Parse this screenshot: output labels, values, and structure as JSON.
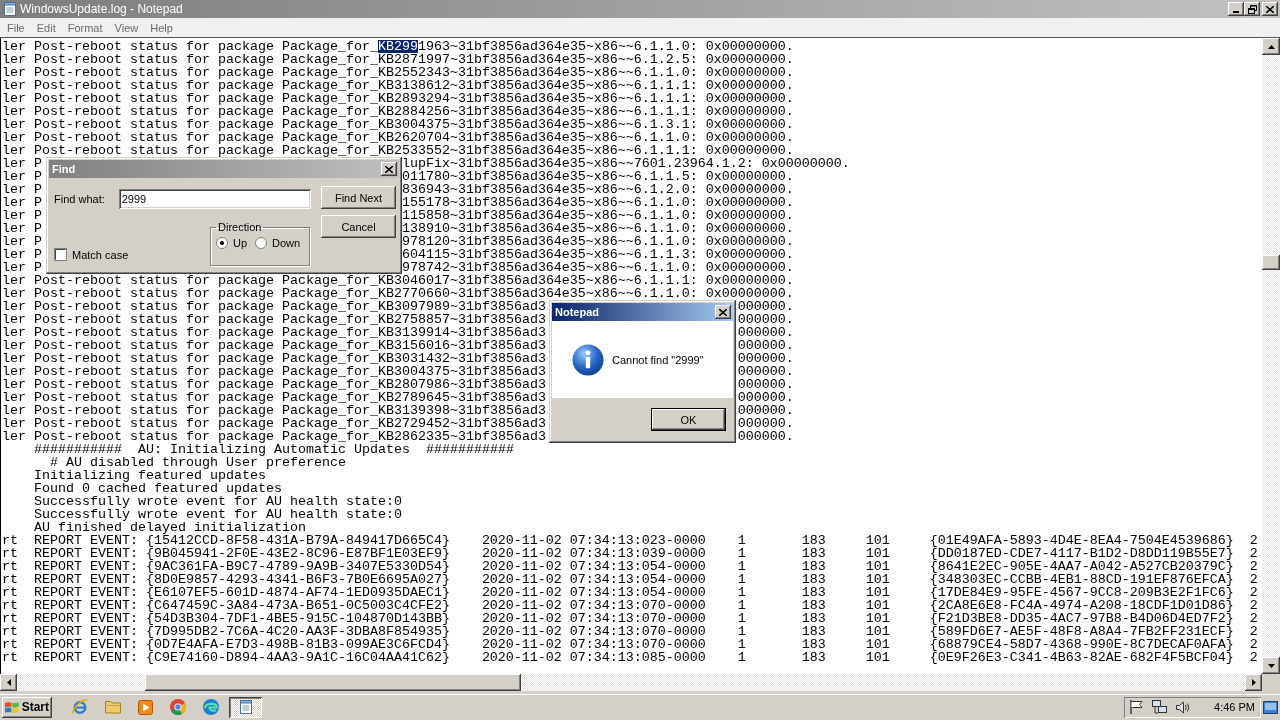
{
  "window": {
    "title": "WindowsUpdate.log - Notepad",
    "active": false
  },
  "menu": [
    "File",
    "Edit",
    "Format",
    "View",
    "Help"
  ],
  "log": {
    "lines": [
      {
        "kind": "full",
        "text": "ler Post-reboot status for package Package_for_",
        "selection": "KB299",
        "after": "1963~31bf3856ad364e35~x86~~6.1.1.0: 0x00000000."
      },
      {
        "kind": "full",
        "text": "ler Post-reboot status for package Package_for_KB2871997~31bf3856ad364e35~x86~~6.1.2.5: 0x00000000."
      },
      {
        "kind": "full",
        "text": "ler Post-reboot status for package Package_for_KB2552343~31bf3856ad364e35~x86~~6.1.1.0: 0x00000000."
      },
      {
        "kind": "full",
        "text": "ler Post-reboot status for package Package_for_KB3138612~31bf3856ad364e35~x86~~6.1.1.1: 0x00000000."
      },
      {
        "kind": "full",
        "text": "ler Post-reboot status for package Package_for_KB2893294~31bf3856ad364e35~x86~~6.1.1.1: 0x00000000."
      },
      {
        "kind": "full",
        "text": "ler Post-reboot status for package Package_for_KB2884256~31bf3856ad364e35~x86~~6.1.1.1: 0x00000000."
      },
      {
        "kind": "full",
        "text": "ler Post-reboot status for package Package_for_KB3004375~31bf3856ad364e35~x86~~6.1.3.1: 0x00000000."
      },
      {
        "kind": "full",
        "text": "ler Post-reboot status for package Package_for_KB2620704~31bf3856ad364e35~x86~~6.1.1.0: 0x00000000."
      },
      {
        "kind": "full",
        "text": "ler Post-reboot status for package Package_for_KB2533552~31bf3856ad364e35~x86~~6.1.1.1: 0x00000000."
      },
      {
        "kind": "behind_find",
        "text": "ler P",
        "tail": "lupFix~31bf3856ad364e35~x86~~7601.23964.1.2: 0x00000000."
      },
      {
        "kind": "behind_find",
        "text": "ler P",
        "tail": "011780~31bf3856ad364e35~x86~~6.1.1.5: 0x00000000."
      },
      {
        "kind": "behind_find",
        "text": "ler P",
        "tail": "836943~31bf3856ad364e35~x86~~6.1.2.0: 0x00000000."
      },
      {
        "kind": "behind_find",
        "text": "ler P",
        "tail": "155178~31bf3856ad364e35~x86~~6.1.1.0: 0x00000000."
      },
      {
        "kind": "behind_find",
        "text": "ler P",
        "tail": "115858~31bf3856ad364e35~x86~~6.1.1.0: 0x00000000."
      },
      {
        "kind": "behind_find",
        "text": "ler P",
        "tail": "138910~31bf3856ad364e35~x86~~6.1.1.0: 0x00000000."
      },
      {
        "kind": "behind_find",
        "text": "ler P",
        "tail": "978120~31bf3856ad364e35~x86~~6.1.1.0: 0x00000000."
      },
      {
        "kind": "behind_find",
        "text": "ler P",
        "tail": "604115~31bf3856ad364e35~x86~~6.1.1.3: 0x00000000."
      },
      {
        "kind": "behind_find",
        "text": "ler P",
        "tail": "978742~31bf3856ad364e35~x86~~6.1.1.0: 0x00000000."
      },
      {
        "kind": "full",
        "text": "ler Post-reboot status for package Package_for_KB3046017~31bf3856ad364e35~x86~~6.1.1.1: 0x00000000."
      },
      {
        "kind": "full",
        "text": "ler Post-reboot status for package Package_for_KB2770660~31bf3856ad364e35~x86~~6.1.1.0: 0x00000000."
      },
      {
        "kind": "behind_message",
        "text": "ler Post-reboot status for package Package_for_KB3097989~31bf3856ad3",
        "tail": "000000."
      },
      {
        "kind": "behind_message",
        "text": "ler Post-reboot status for package Package_for_KB2758857~31bf3856ad3",
        "tail": "000000."
      },
      {
        "kind": "behind_message",
        "text": "ler Post-reboot status for package Package_for_KB3139914~31bf3856ad3",
        "tail": "000000."
      },
      {
        "kind": "behind_message",
        "text": "ler Post-reboot status for package Package_for_KB3156016~31bf3856ad3",
        "tail": "000000."
      },
      {
        "kind": "behind_message",
        "text": "ler Post-reboot status for package Package_for_KB3031432~31bf3856ad3",
        "tail": "000000."
      },
      {
        "kind": "behind_message",
        "text": "ler Post-reboot status for package Package_for_KB3004375~31bf3856ad3",
        "tail": "000000."
      },
      {
        "kind": "behind_message",
        "text": "ler Post-reboot status for package Package_for_KB2807986~31bf3856ad3",
        "tail": "000000."
      },
      {
        "kind": "behind_message",
        "text": "ler Post-reboot status for package Package_for_KB2789645~31bf3856ad3",
        "tail": "000000."
      },
      {
        "kind": "behind_message",
        "text": "ler Post-reboot status for package Package_for_KB3139398~31bf3856ad3",
        "tail": "000000."
      },
      {
        "kind": "behind_message",
        "text": "ler Post-reboot status for package Package_for_KB2729452~31bf3856ad3",
        "tail": "000000."
      },
      {
        "kind": "behind_message",
        "text": "ler Post-reboot status for package Package_for_KB2862335~31bf3856ad3",
        "tail": "000000."
      },
      {
        "kind": "au",
        "text": "###########  AU: Initializing Automatic Updates  ###########"
      },
      {
        "kind": "au_detail",
        "text": "# AU disabled through User preference"
      },
      {
        "kind": "au",
        "text": "Initializing featured updates"
      },
      {
        "kind": "au",
        "text": "Found 0 cached featured updates"
      },
      {
        "kind": "au",
        "text": "Successfully wrote event for AU health state:0"
      },
      {
        "kind": "au",
        "text": "Successfully wrote event for AU health state:0"
      },
      {
        "kind": "au",
        "text": "AU finished delayed initialization"
      }
    ],
    "report_rows": [
      {
        "cells": [
          "rt",
          "REPORT EVENT: {15412CCD-8F58-431A-B79A-849417D665C4}",
          "2020-11-02 07:34:13:023-0000",
          "1",
          "183",
          "101",
          "{01E49AFA-5893-4D4E-8EA4-7504E4539686}",
          "2"
        ]
      },
      {
        "cells": [
          "rt",
          "REPORT EVENT: {9B045941-2F0E-43E2-8C96-E87BF1E03EF9}",
          "2020-11-02 07:34:13:039-0000",
          "1",
          "183",
          "101",
          "{DD0187ED-CDE7-4117-B1D2-D8DD119B55E7}",
          "2"
        ]
      },
      {
        "cells": [
          "rt",
          "REPORT EVENT: {9AC361FA-B9C7-4789-9A9B-3407E5330D54}",
          "2020-11-02 07:34:13:054-0000",
          "1",
          "183",
          "101",
          "{8641E2EC-905E-4AA7-A042-A527CB20379C}",
          "2"
        ]
      },
      {
        "cells": [
          "rt",
          "REPORT EVENT: {8D0E9857-4293-4341-B6F3-7B0E6695A027}",
          "2020-11-02 07:34:13:054-0000",
          "1",
          "183",
          "101",
          "{348303EC-CCBB-4EB1-88CD-191EF876EFCA}",
          "2"
        ]
      },
      {
        "cells": [
          "rt",
          "REPORT EVENT: {E6107EF5-601D-4874-AF74-1ED0935DAEC1}",
          "2020-11-02 07:34:13:054-0000",
          "1",
          "183",
          "101",
          "{17DE84E9-95FE-4567-9CC8-209B3E2F1FC6}",
          "2"
        ]
      },
      {
        "cells": [
          "rt",
          "REPORT EVENT: {C647459C-3A84-473A-B651-0C5003C4CFE2}",
          "2020-11-02 07:34:13:070-0000",
          "1",
          "183",
          "101",
          "{2CA8E6E8-FC4A-4974-A208-18CDF1D01D86}",
          "2"
        ]
      },
      {
        "cells": [
          "rt",
          "REPORT EVENT: {54D3B304-7DF1-4BE5-915C-104870D143BB}",
          "2020-11-02 07:34:13:070-0000",
          "1",
          "183",
          "101",
          "{F21D3BE8-DD35-4AC7-97B8-B4D06D4ED7F2}",
          "2"
        ]
      },
      {
        "cells": [
          "rt",
          "REPORT EVENT: {7D995DB2-7C6A-4C20-AA3F-3DBA8F854935}",
          "2020-11-02 07:34:13:070-0000",
          "1",
          "183",
          "101",
          "{589FD6E7-AE5F-48F8-A8A4-7FB2FF231ECF}",
          "2"
        ]
      },
      {
        "cells": [
          "rt",
          "REPORT EVENT: {0D7E4AFA-E7D3-498B-81B3-099AE3C6FCD4}",
          "2020-11-02 07:34:13:070-0000",
          "1",
          "183",
          "101",
          "{68879CE4-58D7-4368-990E-8C7DECAF0AFA}",
          "2"
        ]
      },
      {
        "cells": [
          "rt",
          "REPORT EVENT: {C9E74160-D894-4AA3-9A1C-16C04AA41C62}",
          "2020-11-02 07:34:13:085-0000",
          "1",
          "183",
          "101",
          "{0E9F26E3-C341-4B63-82AE-682F4F5BCF04}",
          "2"
        ]
      }
    ]
  },
  "find_dialog": {
    "title": "Find",
    "active": false,
    "find_what": {
      "label": "Find what:",
      "value": "2999"
    },
    "match_case": {
      "label": "Match case",
      "checked": false
    },
    "direction": {
      "legend": "Direction",
      "options": [
        {
          "label": "Up",
          "selected": true
        },
        {
          "label": "Down",
          "selected": false
        }
      ]
    },
    "buttons": [
      {
        "label": "Find Next"
      },
      {
        "label": "Cancel"
      }
    ]
  },
  "message_box": {
    "title": "Notepad",
    "active": true,
    "message": "Cannot find \"2999\"",
    "button": "OK"
  },
  "taskbar": {
    "start": "Start",
    "window_buttons": [
      {
        "selected": true
      }
    ],
    "clock": "4:46 PM"
  }
}
